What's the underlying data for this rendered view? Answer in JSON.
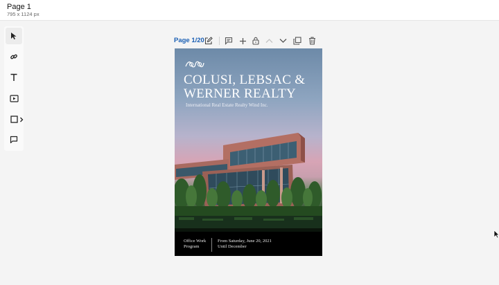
{
  "header": {
    "title": "Page 1",
    "dimensions": "795 x 1124 px"
  },
  "tools": [
    {
      "name": "select",
      "icon": "cursor-arrow-icon"
    },
    {
      "name": "link",
      "icon": "link-icon"
    },
    {
      "name": "text",
      "icon": "text-icon"
    },
    {
      "name": "video",
      "icon": "video-icon"
    },
    {
      "name": "shape",
      "icon": "square-icon"
    },
    {
      "name": "comment",
      "icon": "speech-bubble-icon"
    }
  ],
  "page_toolbar": {
    "page_label": "Page 1/20",
    "icons": [
      "edit-icon",
      "comment-icon",
      "plus-icon",
      "lock-icon",
      "chevron-up-icon",
      "chevron-down-icon",
      "duplicate-icon",
      "trash-icon"
    ]
  },
  "document": {
    "headline": "COLUSI, LEBSAC & WERNER REALTY",
    "subhead": "International Real Estate Realty Wind Inc.",
    "footer_left": "Office Work Program",
    "footer_right": "From Saturday, June 20, 2021 Until December"
  },
  "colors": {
    "accent": "#1a5fb4",
    "toolbar_icon": "#555555"
  }
}
